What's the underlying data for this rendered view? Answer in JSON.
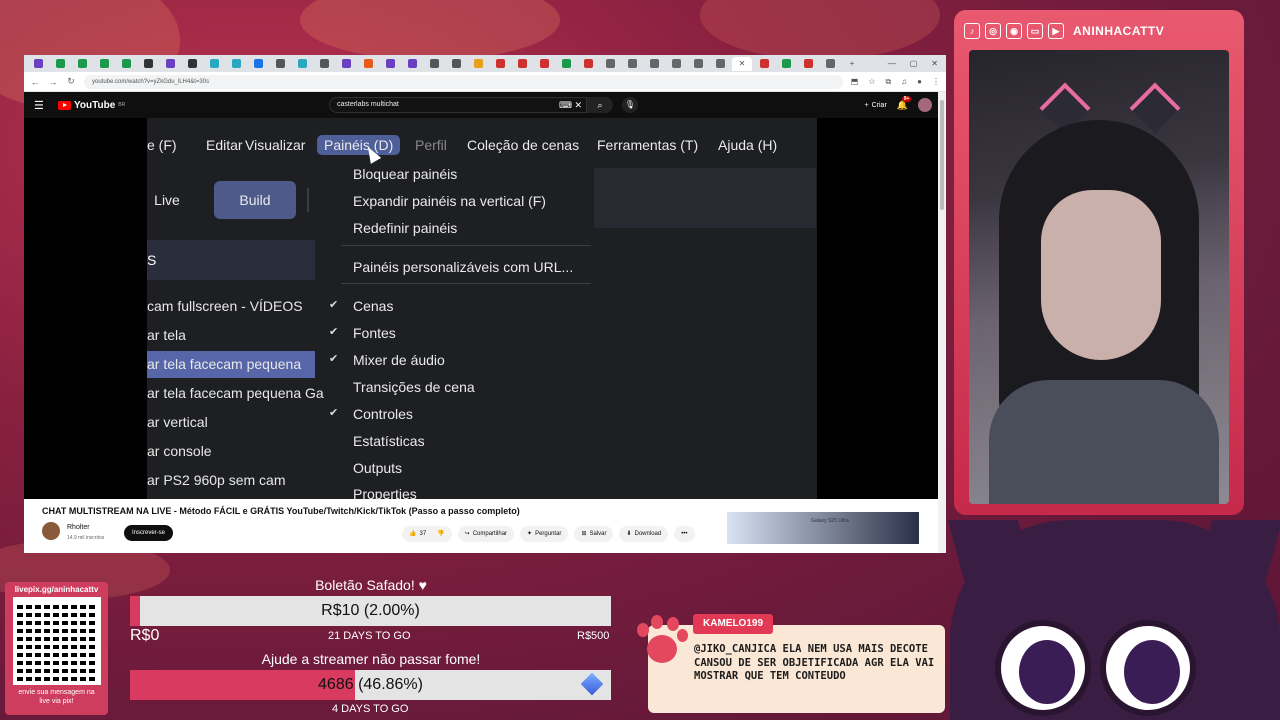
{
  "browser": {
    "tab_icons": [
      "☽",
      "▣",
      "▣",
      "▣",
      "▣",
      "▣",
      "☽",
      "▣",
      "◆",
      "◆",
      "▣",
      "▣",
      "◆",
      "▣",
      "☽",
      "◆",
      "▣",
      "☽",
      "▣",
      "▣",
      "◆",
      "▣",
      "▣",
      "▣",
      "◆",
      "▣",
      "▣",
      "▣",
      "▣",
      "▣",
      "▣",
      "◆",
      "✕",
      "●",
      "◆",
      "▣",
      "▣"
    ],
    "new_tab": "+",
    "url": "youtube.com/watch?v=yZkGdu_lLH4&t=30s"
  },
  "youtube": {
    "logo": "YouTube",
    "logo_suffix": "BR",
    "search_value": "casterlabs multichat",
    "create_label": "Criar",
    "notif_count": "9+",
    "video_title": "CHAT MULTISTREAM NA LIVE - Método FÁCIL e GRÁTIS YouTube/Twitch/Kick/TikTok (Passo a passo completo)",
    "channel_name": "Rholter",
    "channel_subs": "14,9 mil inscritos",
    "subscribe_label": "Inscrever-se",
    "like_count": "37",
    "share_label": "Compartilhar",
    "ask_label": "Perguntar",
    "save_label": "Salvar",
    "download_label": "Download",
    "more_label": "•••",
    "rec_thumb_text": "Galaxy S25 Ultra"
  },
  "obs": {
    "menu": {
      "file": "e (F)",
      "edit": "Editar",
      "view": "Visualizar",
      "docks": "Painéis (D)",
      "profile": "Perfil",
      "scene_collection": "Coleção de cenas",
      "tools": "Ferramentas (T)",
      "help": "Ajuda (H)"
    },
    "mode_live": "Live",
    "mode_build": "Build",
    "scenes_header": "S",
    "scenes": [
      "cam fullscreen - VÍDEOS",
      "ar tela",
      "ar tela facecam pequena",
      "ar tela facecam pequena Ga",
      "ar vertical",
      "ar console",
      "ar PS2 960p sem cam"
    ],
    "dropdown": {
      "lock": "Bloquear painéis",
      "expand": "Expandir painéis na vertical (F)",
      "reset": "Redefinir painéis",
      "custom": "Painéis personalizáveis com URL...",
      "scenes": "Cenas",
      "sources": "Fontes",
      "mixer": "Mixer de áudio",
      "transitions": "Transições de cena",
      "controls": "Controles",
      "stats": "Estatísticas",
      "outputs": "Outputs",
      "properties": "Properties"
    },
    "check": "✔"
  },
  "cam": {
    "channel": "ANINHACATTV",
    "socials": [
      "♪",
      "◎",
      "◉",
      "▭",
      "▶"
    ]
  },
  "qr": {
    "title": "livepix.gg/aninhacattv",
    "footer_1": "envie sua mensagem na",
    "footer_2": "live via pix!"
  },
  "goal1": {
    "title": "Boletão Safado! ♥",
    "bar_text": "R$10 (2.00%)",
    "progress_pct": 2.0,
    "min": "R$0",
    "days": "21 DAYS TO GO",
    "max": "R$500"
  },
  "goal2": {
    "title": "Ajude a streamer não passar fome!",
    "bar_value": "4686",
    "bar_pct": "(46.86%)",
    "progress_pct": 46.86,
    "days": "4 DAYS TO GO"
  },
  "chat": {
    "username": "KAMELO199",
    "message": "@JIKO_CANJICA ELA NEM USA MAIS DECOTE CANSOU DE SER OBJETIFICADA AGR ELA VAI MOSTRAR QUE TEM CONTEUDO"
  }
}
